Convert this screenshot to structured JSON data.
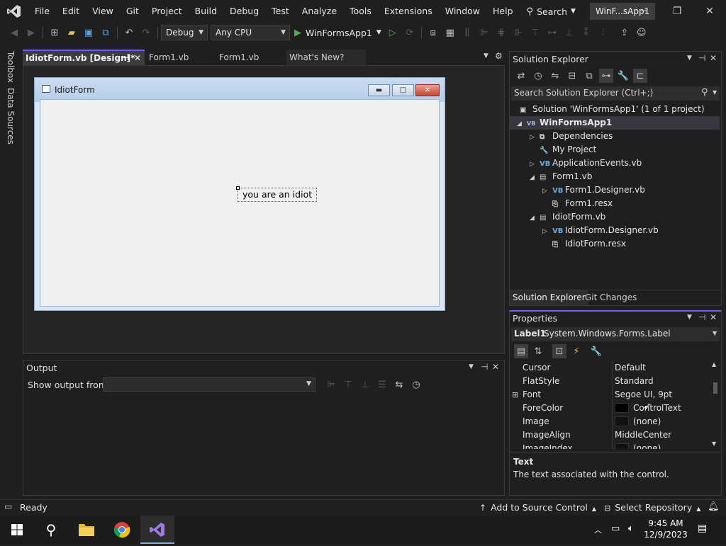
{
  "menubar": {
    "items": [
      "File",
      "Edit",
      "View",
      "Git",
      "Project",
      "Build",
      "Debug",
      "Test",
      "Analyze",
      "Tools",
      "Extensions",
      "Window",
      "Help"
    ],
    "search_label": "Search",
    "title_chip": "WinF...sApp1"
  },
  "toolbar": {
    "config": "Debug",
    "platform": "Any CPU",
    "start_label": "WinFormsApp1"
  },
  "lefttabs": [
    "Toolbox",
    "Data Sources"
  ],
  "doctabs": [
    {
      "label": "IdiotForm.vb [Design]*",
      "active": true
    },
    {
      "label": "Form1.vb",
      "active": false
    },
    {
      "label": "Form1.vb",
      "active": false
    },
    {
      "label": "What's New?",
      "active": false
    }
  ],
  "designer": {
    "form_title": "IdiotForm",
    "label_text": "you are an idiot"
  },
  "output": {
    "title": "Output",
    "show_from_label": "Show output from:",
    "source_value": ""
  },
  "solution_explorer": {
    "title": "Solution Explorer",
    "search_placeholder": "Search Solution Explorer (Ctrl+;)",
    "tree": [
      {
        "label": "Solution 'WinFormsApp1' (1 of 1 project)",
        "expander": "",
        "icon": "▣",
        "bold": false
      },
      {
        "label": "WinFormsApp1",
        "expander": "◢",
        "icon": "VB",
        "bold": true
      },
      {
        "label": "Dependencies",
        "expander": "▷",
        "icon": "⧉",
        "bold": false
      },
      {
        "label": "My Project",
        "expander": "",
        "icon": "🔧",
        "bold": false
      },
      {
        "label": "ApplicationEvents.vb",
        "expander": "▷",
        "icon": "VB",
        "bold": false
      },
      {
        "label": "Form1.vb",
        "expander": "◢",
        "icon": "▤",
        "bold": false
      },
      {
        "label": "Form1.Designer.vb",
        "expander": "▷",
        "icon": "VB",
        "bold": false
      },
      {
        "label": "Form1.resx",
        "expander": "",
        "icon": "⎘",
        "bold": false
      },
      {
        "label": "IdiotForm.vb",
        "expander": "◢",
        "icon": "▤",
        "bold": false
      },
      {
        "label": "IdiotForm.Designer.vb",
        "expander": "▷",
        "icon": "VB",
        "bold": false
      },
      {
        "label": "IdiotForm.resx",
        "expander": "",
        "icon": "⎘",
        "bold": false
      }
    ],
    "bottom_tabs": [
      "Solution Explorer",
      "Git Changes"
    ]
  },
  "properties": {
    "title": "Properties",
    "object_name": "Label1",
    "object_type": "System.Windows.Forms.Label",
    "rows": [
      {
        "name": "Cursor",
        "value": "Default",
        "expand": false,
        "swatch": false
      },
      {
        "name": "FlatStyle",
        "value": "Standard",
        "expand": false,
        "swatch": false
      },
      {
        "name": "Font",
        "value": "Segoe UI, 9pt",
        "expand": true,
        "swatch": false
      },
      {
        "name": "ForeColor",
        "value": "ControlText",
        "expand": false,
        "swatch": true
      },
      {
        "name": "Image",
        "value": "(none)",
        "expand": false,
        "swatch": true
      },
      {
        "name": "ImageAlign",
        "value": "MiddleCenter",
        "expand": false,
        "swatch": false
      },
      {
        "name": "ImageIndex",
        "value": "(none)",
        "expand": false,
        "swatch": true
      }
    ],
    "desc_title": "Text",
    "desc_text": "The text associated with the control."
  },
  "statusbar": {
    "status": "Ready",
    "source_control": "Add to Source Control",
    "repository": "Select Repository"
  },
  "taskbar": {
    "time": "9:45 AM",
    "date": "12/9/2023"
  },
  "colors": {
    "accent": "#7160e8",
    "vb_blue": "#6fa8e6",
    "run_green": "#4caf50"
  }
}
